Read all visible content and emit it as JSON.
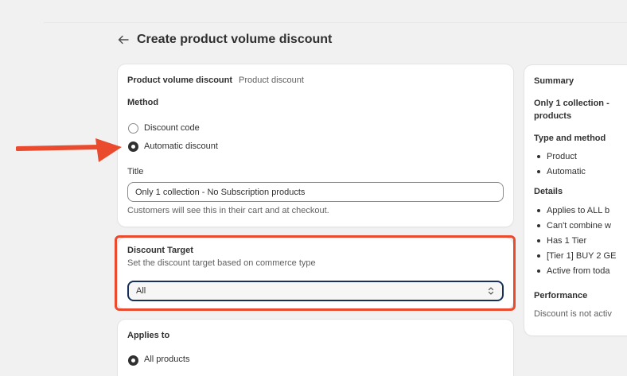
{
  "page": {
    "title": "Create product volume discount"
  },
  "main_card": {
    "heading": "Product volume discount",
    "heading_sub": "Product discount",
    "method_label": "Method",
    "methods": [
      {
        "label": "Discount code",
        "selected": false
      },
      {
        "label": "Automatic discount",
        "selected": true
      }
    ],
    "title_label": "Title",
    "title_value": "Only 1 collection - No Subscription products",
    "title_help": "Customers will see this in their cart and at checkout."
  },
  "target_card": {
    "heading": "Discount Target",
    "description": "Set the discount target based on commerce type",
    "select_value": "All"
  },
  "applies_card": {
    "heading": "Applies to",
    "first_option": "All products"
  },
  "summary": {
    "heading": "Summary",
    "title_line1": "Only 1 collection -",
    "title_line2": "products",
    "type_heading": "Type and method",
    "type_items": [
      "Product",
      "Automatic"
    ],
    "details_heading": "Details",
    "details_items": [
      "Applies to ALL b",
      "Can't combine w",
      "Has 1 Tier",
      "[Tier 1] BUY 2 GE",
      "Active from toda"
    ],
    "performance_heading": "Performance",
    "performance_text": "Discount is not activ"
  },
  "colors": {
    "annotation": "#ea4b2e",
    "select_border": "#16305a",
    "background": "#f1f1f1"
  },
  "icons": {
    "back": "arrow-left-icon",
    "select": "chevron-up-down-icon",
    "annotation": "arrow-right-icon"
  }
}
